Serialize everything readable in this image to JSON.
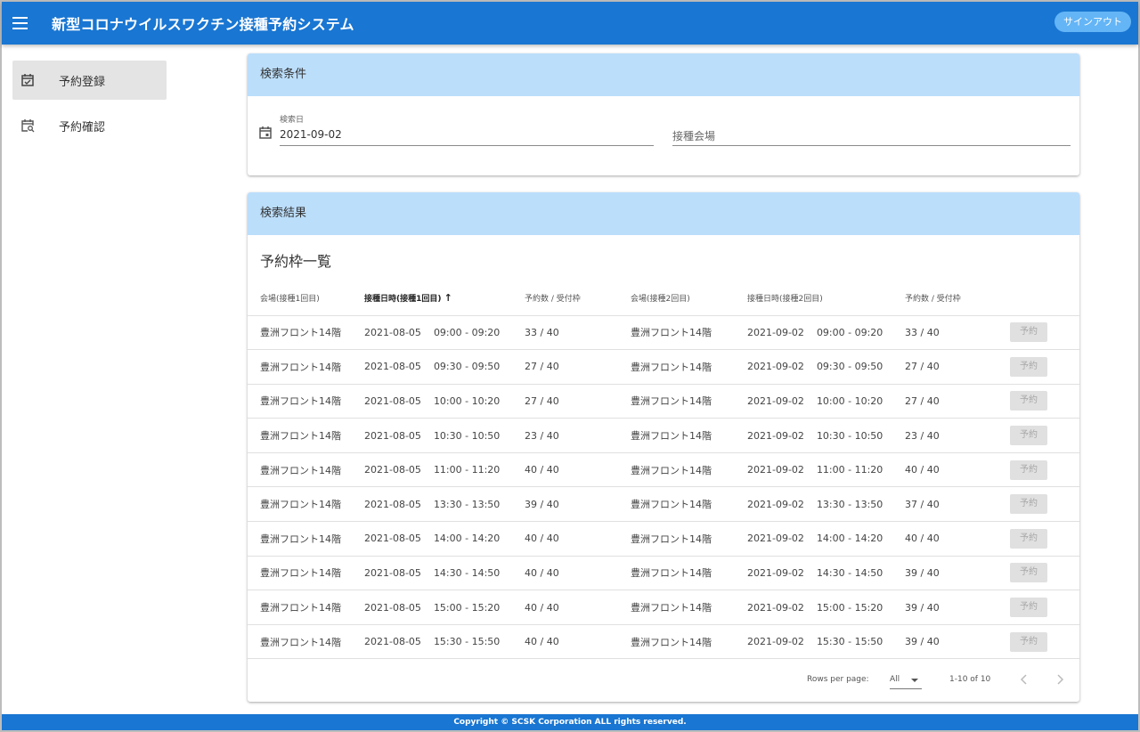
{
  "app": {
    "title": "新型コロナウイルスワクチン接種予約システム",
    "signout_label": "サインアウト"
  },
  "nav": {
    "items": [
      {
        "label": "予約登録",
        "icon": "calendar-check-icon",
        "active": true
      },
      {
        "label": "予約確認",
        "icon": "calendar-search-icon",
        "active": false
      }
    ]
  },
  "search": {
    "header": "検索条件",
    "date_label": "検索日",
    "date_value": "2021-09-02",
    "venue_placeholder": "接種会場"
  },
  "results": {
    "header": "検索結果",
    "title": "予約枠一覧",
    "columns": [
      "会場(接種1回目)",
      "接種日時(接種1回目)",
      "予約数 / 受付枠",
      "会場(接種2回目)",
      "接種日時(接種2回目)",
      "予約数 / 受付枠"
    ],
    "sorted_column": 1,
    "sort_arrow": "↑",
    "button_label": "予約",
    "rows": [
      {
        "venue1": "豊洲フロント14階",
        "date1": "2021-08-05",
        "time1": "09:00 - 09:20",
        "count1": "33 / 40",
        "venue2": "豊洲フロント14階",
        "date2": "2021-09-02",
        "time2": "09:00 - 09:20",
        "count2": "33 / 40"
      },
      {
        "venue1": "豊洲フロント14階",
        "date1": "2021-08-05",
        "time1": "09:30 - 09:50",
        "count1": "27 / 40",
        "venue2": "豊洲フロント14階",
        "date2": "2021-09-02",
        "time2": "09:30 - 09:50",
        "count2": "27 / 40"
      },
      {
        "venue1": "豊洲フロント14階",
        "date1": "2021-08-05",
        "time1": "10:00 - 10:20",
        "count1": "27 / 40",
        "venue2": "豊洲フロント14階",
        "date2": "2021-09-02",
        "time2": "10:00 - 10:20",
        "count2": "27 / 40"
      },
      {
        "venue1": "豊洲フロント14階",
        "date1": "2021-08-05",
        "time1": "10:30 - 10:50",
        "count1": "23 / 40",
        "venue2": "豊洲フロント14階",
        "date2": "2021-09-02",
        "time2": "10:30 - 10:50",
        "count2": "23 / 40"
      },
      {
        "venue1": "豊洲フロント14階",
        "date1": "2021-08-05",
        "time1": "11:00 - 11:20",
        "count1": "40 / 40",
        "venue2": "豊洲フロント14階",
        "date2": "2021-09-02",
        "time2": "11:00 - 11:20",
        "count2": "40 / 40"
      },
      {
        "venue1": "豊洲フロント14階",
        "date1": "2021-08-05",
        "time1": "13:30 - 13:50",
        "count1": "39 / 40",
        "venue2": "豊洲フロント14階",
        "date2": "2021-09-02",
        "time2": "13:30 - 13:50",
        "count2": "37 / 40"
      },
      {
        "venue1": "豊洲フロント14階",
        "date1": "2021-08-05",
        "time1": "14:00 - 14:20",
        "count1": "40 / 40",
        "venue2": "豊洲フロント14階",
        "date2": "2021-09-02",
        "time2": "14:00 - 14:20",
        "count2": "40 / 40"
      },
      {
        "venue1": "豊洲フロント14階",
        "date1": "2021-08-05",
        "time1": "14:30 - 14:50",
        "count1": "40 / 40",
        "venue2": "豊洲フロント14階",
        "date2": "2021-09-02",
        "time2": "14:30 - 14:50",
        "count2": "39 / 40"
      },
      {
        "venue1": "豊洲フロント14階",
        "date1": "2021-08-05",
        "time1": "15:00 - 15:20",
        "count1": "40 / 40",
        "venue2": "豊洲フロント14階",
        "date2": "2021-09-02",
        "time2": "15:00 - 15:20",
        "count2": "39 / 40"
      },
      {
        "venue1": "豊洲フロント14階",
        "date1": "2021-08-05",
        "time1": "15:30 - 15:50",
        "count1": "40 / 40",
        "venue2": "豊洲フロント14階",
        "date2": "2021-09-02",
        "time2": "15:30 - 15:50",
        "count2": "39 / 40"
      }
    ],
    "pagination": {
      "rows_per_page_label": "Rows per page:",
      "rows_per_page_value": "All",
      "range": "1-10 of 10",
      "prev_icon": "chevron-left-icon",
      "next_icon": "chevron-right-icon"
    }
  },
  "footer": {
    "copyright": "Copyright © SCSK Corporation ALL rights reserved."
  },
  "colors": {
    "primary": "#1976d2",
    "header_bg": "#bbdefb",
    "signout_bg": "#64b5f6",
    "nav_active_bg": "#e4e4e4",
    "disabled_button_bg": "#e0e0e0"
  }
}
